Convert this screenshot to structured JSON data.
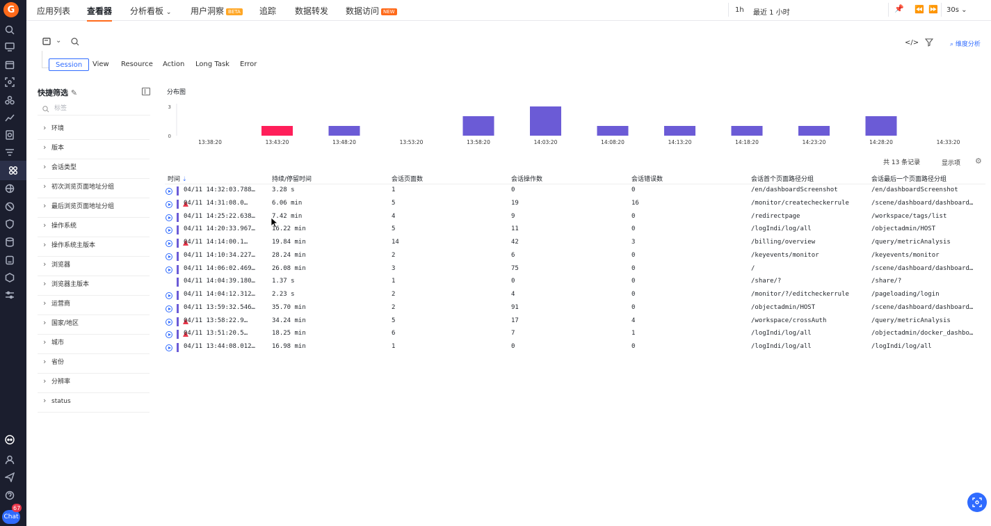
{
  "nav": {
    "logo": "G",
    "chat_label": "Chat",
    "chat_badge": "67"
  },
  "topbar": {
    "tabs": [
      {
        "label": "应用列表"
      },
      {
        "label": "查看器",
        "active": true
      },
      {
        "label": "分析看板"
      },
      {
        "label": "用户洞察",
        "badge": "BETA"
      },
      {
        "label": "追踪"
      },
      {
        "label": "数据转发"
      },
      {
        "label": "数据访问",
        "badge": "NEW"
      }
    ],
    "time_short": "1h",
    "time_range": "最近 1 小时",
    "refresh_interval": "30s"
  },
  "toolbar": {
    "dimension_analysis": "维度分析"
  },
  "subtabs": [
    "Session",
    "View",
    "Resource",
    "Action",
    "Long Task",
    "Error"
  ],
  "quick_filter": {
    "title": "快捷筛选",
    "search_placeholder": "标签",
    "items": [
      "环境",
      "版本",
      "会话类型",
      "初次浏览页面地址分组",
      "最后浏览页面地址分组",
      "操作系统",
      "操作系统主版本",
      "浏览器",
      "浏览器主版本",
      "运营商",
      "国家/地区",
      "城市",
      "省份",
      "分辨率",
      "status"
    ]
  },
  "chart_data": {
    "type": "bar",
    "title": "分布图",
    "categories": [
      "13:38:20",
      "13:43:20",
      "13:48:20",
      "13:53:20",
      "13:58:20",
      "14:03:20",
      "14:08:20",
      "14:13:20",
      "14:18:20",
      "14:23:20",
      "14:28:20",
      "14:33:20"
    ],
    "values": [
      0,
      1,
      1,
      0,
      2,
      3,
      1,
      1,
      1,
      1,
      2,
      0
    ],
    "bar_colors": [
      "#6b5bd6",
      "#ff1f5a",
      "#6b5bd6",
      "#6b5bd6",
      "#6b5bd6",
      "#6b5bd6",
      "#6b5bd6",
      "#6b5bd6",
      "#6b5bd6",
      "#6b5bd6",
      "#6b5bd6",
      "#6b5bd6"
    ],
    "y_ticks": [
      "3",
      "0"
    ],
    "ylim": [
      0,
      3
    ]
  },
  "table": {
    "record_count": "共 13 条记录",
    "display_label": "显示项",
    "columns": [
      "时间",
      "持续/停留时间",
      "会话页面数",
      "会话操作数",
      "会话错误数",
      "会话首个页面路径分组",
      "会话最后一个页面路径分组"
    ],
    "rows": [
      {
        "time": "04/11 14:32:03.788…",
        "duration": "3.28 s",
        "pages": "1",
        "actions": "0",
        "errors": "0",
        "first": "/en/dashboardScreenshot",
        "last": "/en/dashboardScreenshot",
        "play": true,
        "warn": false
      },
      {
        "time": "04/11 14:31:08.0…",
        "duration": "6.06 min",
        "pages": "5",
        "actions": "19",
        "errors": "16",
        "first": "/monitor/createcheckerrule",
        "last": "/scene/dashboard/dashboard…",
        "play": true,
        "warn": true
      },
      {
        "time": "04/11 14:25:22.638…",
        "duration": "7.42 min",
        "pages": "4",
        "actions": "9",
        "errors": "0",
        "first": "/redirectpage",
        "last": "/workspace/tags/list",
        "play": true,
        "warn": false
      },
      {
        "time": "04/11 14:20:33.967…",
        "duration": "16.22 min",
        "pages": "5",
        "actions": "11",
        "errors": "0",
        "first": "/logIndi/log/all",
        "last": "/objectadmin/HOST",
        "play": true,
        "warn": false
      },
      {
        "time": "04/11 14:14:00.1…",
        "duration": "19.84 min",
        "pages": "14",
        "actions": "42",
        "errors": "3",
        "first": "/billing/overview",
        "last": "/query/metricAnalysis",
        "play": true,
        "warn": true
      },
      {
        "time": "04/11 14:10:34.227…",
        "duration": "28.24 min",
        "pages": "2",
        "actions": "6",
        "errors": "0",
        "first": "/keyevents/monitor",
        "last": "/keyevents/monitor",
        "play": true,
        "warn": false
      },
      {
        "time": "04/11 14:06:02.469…",
        "duration": "26.08 min",
        "pages": "3",
        "actions": "75",
        "errors": "0",
        "first": "/",
        "last": "/scene/dashboard/dashboard…",
        "play": true,
        "warn": false
      },
      {
        "time": "04/11 14:04:39.180…",
        "duration": "1.37 s",
        "pages": "1",
        "actions": "0",
        "errors": "0",
        "first": "/share/?",
        "last": "/share/?",
        "play": false,
        "warn": false
      },
      {
        "time": "04/11 14:04:12.312…",
        "duration": "2.23 s",
        "pages": "2",
        "actions": "4",
        "errors": "0",
        "first": "/monitor/?/editcheckerrule",
        "last": "/pageloading/login",
        "play": true,
        "warn": false
      },
      {
        "time": "04/11 13:59:32.546…",
        "duration": "35.70 min",
        "pages": "2",
        "actions": "91",
        "errors": "0",
        "first": "/objectadmin/HOST",
        "last": "/scene/dashboard/dashboard…",
        "play": true,
        "warn": false
      },
      {
        "time": "04/11 13:58:22.9…",
        "duration": "34.24 min",
        "pages": "5",
        "actions": "17",
        "errors": "4",
        "first": "/workspace/crossAuth",
        "last": "/query/metricAnalysis",
        "play": true,
        "warn": true
      },
      {
        "time": "04/11 13:51:20.5…",
        "duration": "18.25 min",
        "pages": "6",
        "actions": "7",
        "errors": "1",
        "first": "/logIndi/log/all",
        "last": "/objectadmin/docker_dashbo…",
        "play": true,
        "warn": true
      },
      {
        "time": "04/11 13:44:08.012…",
        "duration": "16.98 min",
        "pages": "1",
        "actions": "0",
        "errors": "0",
        "first": "/logIndi/log/all",
        "last": "/logIndi/log/all",
        "play": true,
        "warn": false
      }
    ]
  }
}
